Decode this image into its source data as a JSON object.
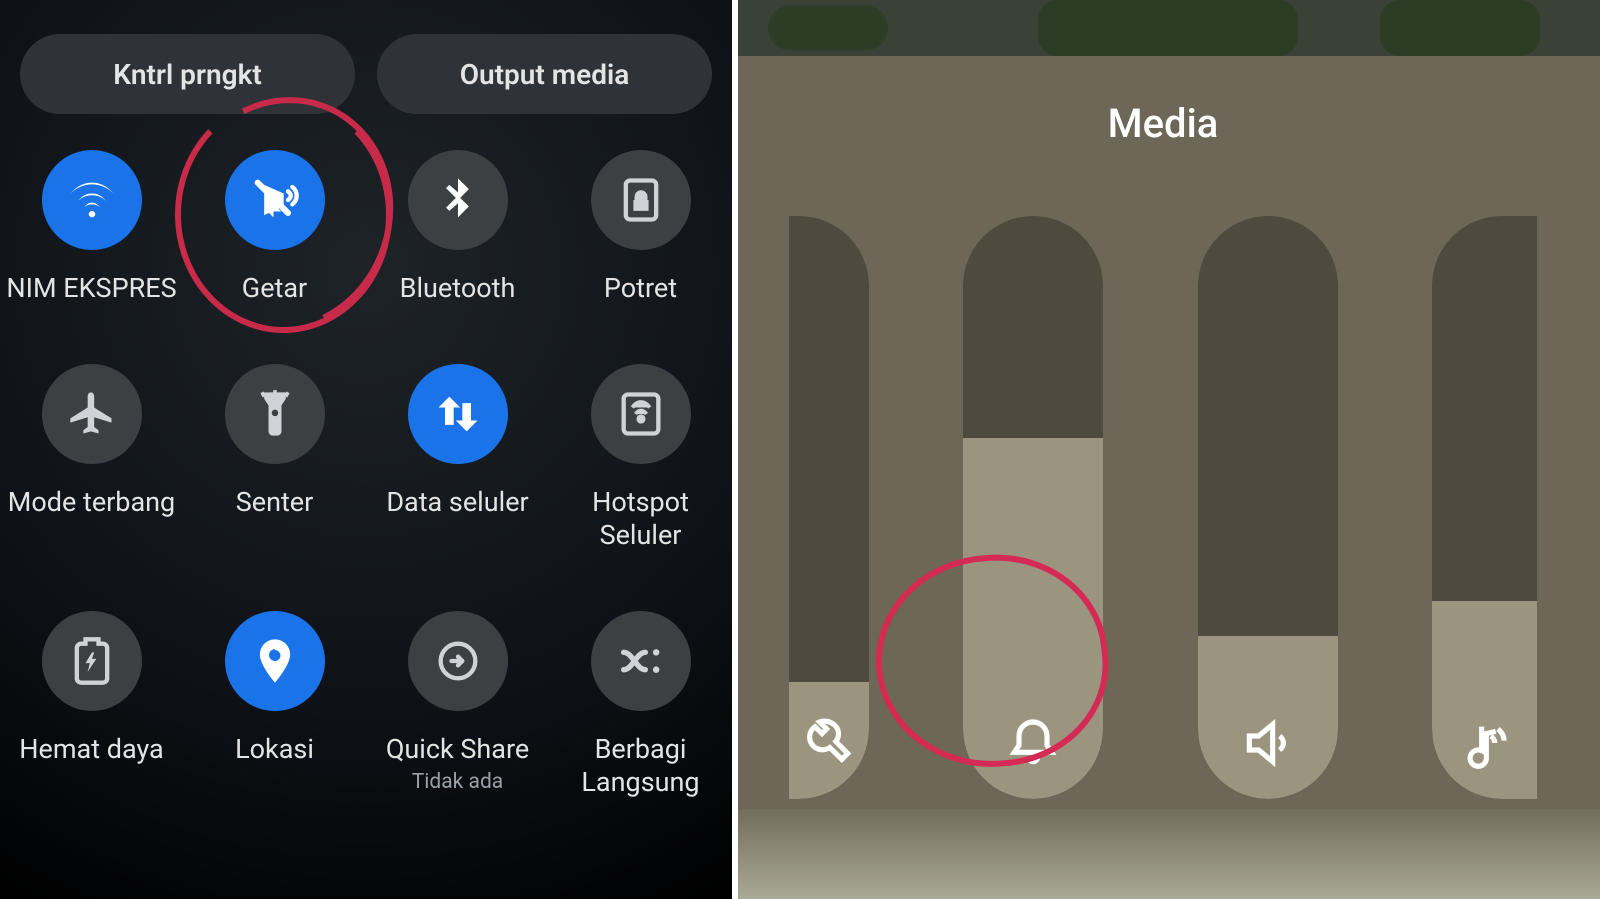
{
  "left": {
    "pills": {
      "device": "Kntrl prngkt",
      "media": "Output media"
    },
    "rows": [
      [
        {
          "label": "NIM EKSPRES",
          "icon": "wifi",
          "on": true
        },
        {
          "label": "Getar",
          "icon": "vibrate",
          "on": true
        },
        {
          "label": "Bluetooth",
          "icon": "bt",
          "on": false
        },
        {
          "label": "Potret",
          "icon": "lock",
          "on": false
        }
      ],
      [
        {
          "label": "Mode terbang",
          "icon": "plane",
          "on": false
        },
        {
          "label": "Senter",
          "icon": "torch",
          "on": false
        },
        {
          "label": "Data seluler",
          "icon": "data",
          "on": true
        },
        {
          "label": "Hotspot Seluler",
          "icon": "hotspot",
          "on": false
        }
      ],
      [
        {
          "label": "Hemat daya",
          "icon": "battery",
          "on": false
        },
        {
          "label": "Lokasi",
          "icon": "pin",
          "on": true
        },
        {
          "label": "Quick Share",
          "sub": "Tidak ada",
          "icon": "share",
          "on": false
        },
        {
          "label": "Berbagi Langsung",
          "icon": "shuffle",
          "on": false
        }
      ]
    ]
  },
  "right": {
    "title": "Media",
    "sliders": [
      {
        "icon": "wrench",
        "fill": 0.2,
        "partial": "left"
      },
      {
        "icon": "bell",
        "fill": 0.62
      },
      {
        "icon": "speaker",
        "fill": 0.28
      },
      {
        "icon": "note",
        "fill": 0.34,
        "partial": "right"
      }
    ]
  }
}
